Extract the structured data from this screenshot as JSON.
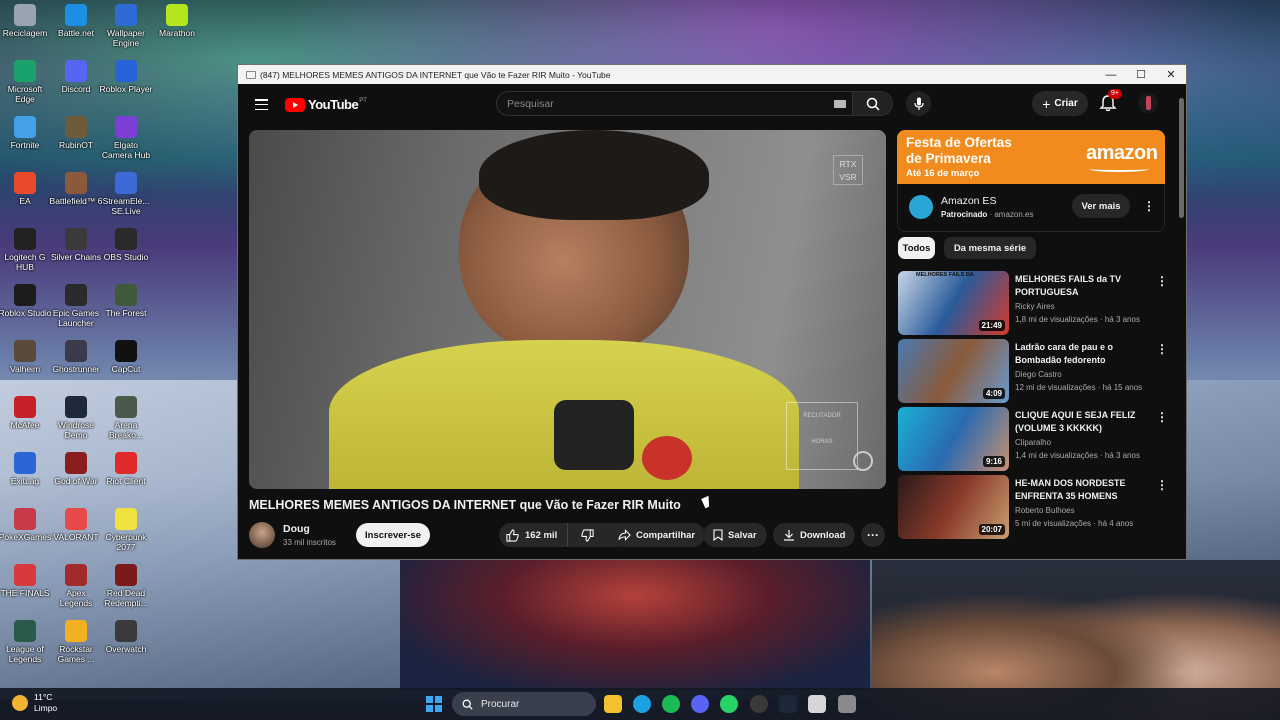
{
  "desktop": {
    "icons": [
      {
        "label": "Reciclagem",
        "color": "#9aa3b0"
      },
      {
        "label": "Battle.net",
        "color": "#1a8fe3"
      },
      {
        "label": "Wallpaper Engine",
        "color": "#2e6bd6"
      },
      {
        "label": "Marathon",
        "color": "#b5e61d"
      },
      {
        "label": "Microsoft Edge",
        "color": "#1ba16a"
      },
      {
        "label": "Discord",
        "color": "#5865f2"
      },
      {
        "label": "Roblox Player",
        "color": "#2663d9"
      },
      {
        "label": "Fortnite",
        "color": "#44a0e8"
      },
      {
        "label": "RubinOT",
        "color": "#6e5b3a"
      },
      {
        "label": "Elgato Camera Hub",
        "color": "#7e3fd6"
      },
      {
        "label": "EA",
        "color": "#e84a2a"
      },
      {
        "label": "Battlefield™ 6",
        "color": "#8a5a3a"
      },
      {
        "label": "StreamEle... SE.Live",
        "color": "#3d6ad6"
      },
      {
        "label": "Logitech G HUB",
        "color": "#222222"
      },
      {
        "label": "Silver Chains",
        "color": "#3a3a3a"
      },
      {
        "label": "OBS Studio",
        "color": "#2a2a2a"
      },
      {
        "label": "Roblox Studio",
        "color": "#1c1c1c"
      },
      {
        "label": "Epic Games Launcher",
        "color": "#2a2a2a"
      },
      {
        "label": "The Forest",
        "color": "#3f5a3a"
      },
      {
        "label": "Valheim",
        "color": "#5a4a3a"
      },
      {
        "label": "Ghostrunner",
        "color": "#3a3a4a"
      },
      {
        "label": "CapCut",
        "color": "#111111"
      },
      {
        "label": "McAfee",
        "color": "#c8202a"
      },
      {
        "label": "Windrose Demo",
        "color": "#1e2a3a"
      },
      {
        "label": "Arena Breako...",
        "color": "#4a5a4a"
      },
      {
        "label": "ExitLag",
        "color": "#2a66d6"
      },
      {
        "label": "God of War",
        "color": "#8a1e1e"
      },
      {
        "label": "Riot Client",
        "color": "#e02a2a"
      },
      {
        "label": "PokeXGames",
        "color": "#c83a4a"
      },
      {
        "label": "VALORANT",
        "color": "#e84a4a"
      },
      {
        "label": "Cyberpunk 2077",
        "color": "#f0e040"
      },
      {
        "label": "THE FINALS",
        "color": "#d63a3a"
      },
      {
        "label": "Apex Legends",
        "color": "#a22a2a"
      },
      {
        "label": "Red Dead Redempti...",
        "color": "#7a1a1a"
      },
      {
        "label": "League of Legends",
        "color": "#2a5a4a"
      },
      {
        "label": "Rockstar Games ...",
        "color": "#f0b020"
      },
      {
        "label": "Overwatch",
        "color": "#3a3a3a"
      }
    ]
  },
  "taskbar": {
    "temperature": "11°C",
    "condition": "Limpo",
    "search_label": "Procurar",
    "apps": [
      "file-explorer",
      "edge",
      "spotify",
      "discord",
      "whatsapp",
      "obs",
      "steam",
      "logitech",
      "settings"
    ]
  },
  "window": {
    "title": "(847) MELHORES MEMES ANTIGOS DA INTERNET que Vão te Fazer RIR Muito - YouTube",
    "minimize": "—",
    "maximize": "☐",
    "close": "✕"
  },
  "youtube": {
    "logo_text": "YouTube",
    "country_code": "PT",
    "search_placeholder": "Pesquisar",
    "create_label": "Criar",
    "notif_count": "9+",
    "player_overlay": "RTX VSR",
    "watermark_line1": "RECUTADOR",
    "watermark_line2": "HORAS",
    "video_title": "MELHORES MEMES ANTIGOS DA INTERNET que Vão te Fazer RIR Muito",
    "channel_name": "Doug",
    "channel_subs": "33 mil inscritos",
    "subscribe_label": "Inscrever-se",
    "like_count": "162 mil",
    "share_label": "Compartilhar",
    "save_label": "Salvar",
    "download_label": "Download",
    "more_label": "···"
  },
  "ad": {
    "headline1": "Festa de Ofertas",
    "headline2": "de Primavera",
    "date": "Até 16 de março",
    "brand": "amazon",
    "advertiser": "Amazon ES",
    "sponsored": "Patrocinado",
    "domain": "amazon.es",
    "cta": "Ver mais"
  },
  "chips": [
    "Todos",
    "Da mesma série"
  ],
  "recommendations": [
    {
      "title": "MELHORES FAILS da TV PORTUGUESA",
      "channel": "Ricky Aires",
      "meta": "1,8 mi de visualizações · há 3 anos",
      "duration": "21:49",
      "thumb_caption": "MELHORES FAILS DA",
      "colors": [
        "#c8d6e6",
        "#2a5a9a",
        "#d63a2a"
      ]
    },
    {
      "title": "Ladrão cara de pau e o Bombadão fedorento",
      "channel": "Diego Castro",
      "meta": "12 mi de visualizações · há 15 anos",
      "duration": "4:09",
      "thumb_caption": "",
      "colors": [
        "#4a7ab0",
        "#8a5a3a",
        "#6a9ad0"
      ]
    },
    {
      "title": "CLIQUE AQUI E SEJA FELIZ (VOLUME 3 KKKKK)",
      "channel": "Cliparalho",
      "meta": "1,4 mi de visualizações · há 3 anos",
      "duration": "9:16",
      "thumb_caption": "",
      "colors": [
        "#1ab0d6",
        "#2a6ab0",
        "#c89070"
      ]
    },
    {
      "title": "HE-MAN DOS NORDESTE ENFRENTA 35 HOMENS",
      "channel": "Roberto Bulhoes",
      "meta": "5 mi de visualizações · há 4 anos",
      "duration": "20:07",
      "thumb_caption": "",
      "colors": [
        "#2a1a1a",
        "#8a3a2a",
        "#c8a070"
      ]
    }
  ]
}
